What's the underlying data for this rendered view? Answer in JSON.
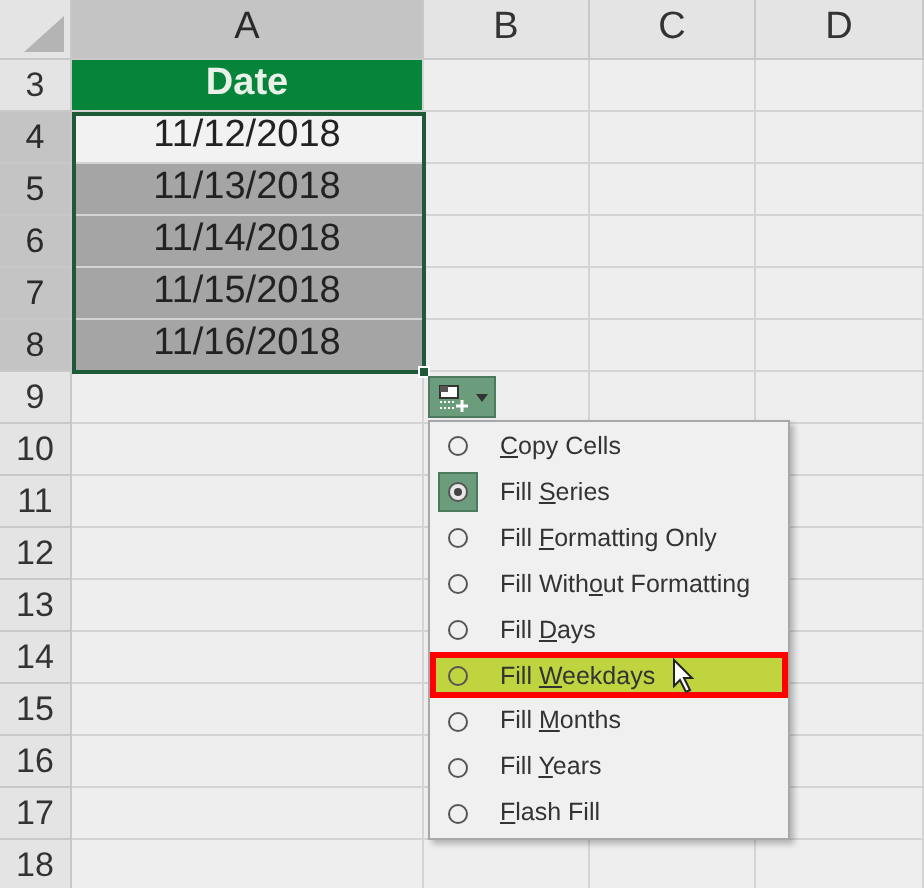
{
  "columns": [
    {
      "label": "A",
      "selected": true
    },
    {
      "label": "B",
      "selected": false
    },
    {
      "label": "C",
      "selected": false
    },
    {
      "label": "D",
      "selected": false
    }
  ],
  "rows": [
    {
      "number": "3",
      "selected": false,
      "cells": [
        {
          "kind": "header",
          "text": "Date"
        }
      ]
    },
    {
      "number": "4",
      "selected": true,
      "cells": [
        {
          "kind": "date",
          "text": "11/12/2018",
          "selected": false
        }
      ]
    },
    {
      "number": "5",
      "selected": true,
      "cells": [
        {
          "kind": "date",
          "text": "11/13/2018",
          "selected": true
        }
      ]
    },
    {
      "number": "6",
      "selected": true,
      "cells": [
        {
          "kind": "date",
          "text": "11/14/2018",
          "selected": true
        }
      ]
    },
    {
      "number": "7",
      "selected": true,
      "cells": [
        {
          "kind": "date",
          "text": "11/15/2018",
          "selected": true
        }
      ]
    },
    {
      "number": "8",
      "selected": true,
      "cells": [
        {
          "kind": "date",
          "text": "11/16/2018",
          "selected": true
        }
      ]
    },
    {
      "number": "9",
      "selected": false,
      "cells": []
    },
    {
      "number": "10",
      "selected": false,
      "cells": []
    },
    {
      "number": "11",
      "selected": false,
      "cells": []
    },
    {
      "number": "12",
      "selected": false,
      "cells": []
    },
    {
      "number": "13",
      "selected": false,
      "cells": []
    },
    {
      "number": "14",
      "selected": false,
      "cells": []
    },
    {
      "number": "15",
      "selected": false,
      "cells": []
    },
    {
      "number": "16",
      "selected": false,
      "cells": []
    },
    {
      "number": "17",
      "selected": false,
      "cells": []
    },
    {
      "number": "18",
      "selected": false,
      "cells": []
    }
  ],
  "autofill_menu": {
    "items": [
      {
        "key": "C",
        "post": "opy Cells",
        "selected": false,
        "highlighted": false
      },
      {
        "pre": "Fill ",
        "key": "S",
        "post": "eries",
        "selected": true,
        "highlighted": false
      },
      {
        "pre": "Fill ",
        "key": "F",
        "post": "ormatting Only",
        "selected": false,
        "highlighted": false
      },
      {
        "pre": "Fill With",
        "key": "o",
        "post": "ut Formatting",
        "selected": false,
        "highlighted": false
      },
      {
        "pre": "Fill ",
        "key": "D",
        "post": "ays",
        "selected": false,
        "highlighted": false
      },
      {
        "pre": "Fill ",
        "key": "W",
        "post": "eekdays",
        "selected": false,
        "highlighted": true
      },
      {
        "pre": "Fill ",
        "key": "M",
        "post": "onths",
        "selected": false,
        "highlighted": false
      },
      {
        "pre": "Fill ",
        "key": "Y",
        "post": "ears",
        "selected": false,
        "highlighted": false
      },
      {
        "key": "F",
        "post": "lash Fill",
        "selected": false,
        "highlighted": false
      }
    ]
  }
}
